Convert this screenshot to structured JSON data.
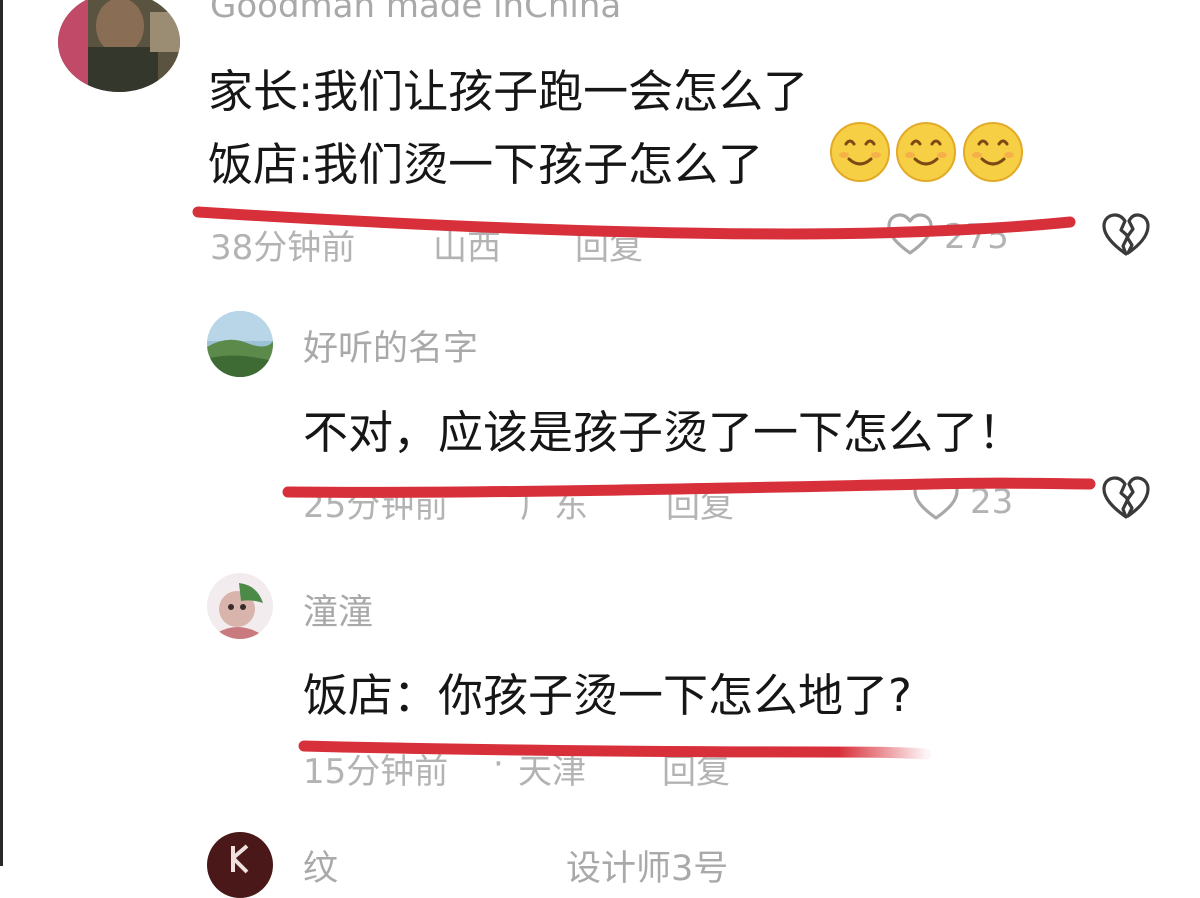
{
  "comments": [
    {
      "username": "Goodman made inChina",
      "lines": [
        "家长:我们让孩子跑一会怎么了",
        "饭店:我们烫一下孩子怎么了"
      ],
      "emojis": [
        "smiley-emoji",
        "smiley-emoji",
        "smiley-emoji"
      ],
      "time": "38分钟前",
      "location": "山西",
      "reply": "回复",
      "likes": "275"
    },
    {
      "username": "好听的名字",
      "text": "不对，应该是孩子烫了一下怎么了！",
      "time": "25分钟前",
      "location": "广东",
      "reply": "回复",
      "likes": "23"
    },
    {
      "username": "潼潼",
      "text": "饭店：你孩子烫一下怎么地了?",
      "time": "15分钟前",
      "separator": "·",
      "location": "天津",
      "reply": "回复"
    },
    {
      "username": "纹",
      "text": "设计师3号"
    }
  ],
  "colors": {
    "annotation_red": "#d8303a",
    "username_gray": "#a9a9a9",
    "text_black": "#161616",
    "meta_gray": "#b3b3b3"
  }
}
